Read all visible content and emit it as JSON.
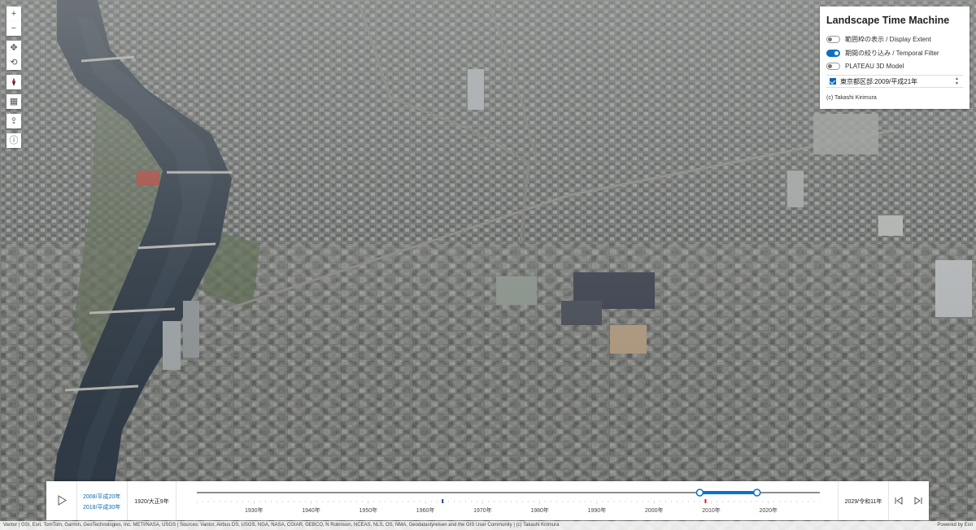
{
  "nav_tools": [
    {
      "name": "zoom-in-button",
      "icon": "plus-icon",
      "glyph": "+"
    },
    {
      "name": "zoom-out-button",
      "icon": "minus-icon",
      "glyph": "−"
    },
    {
      "name": "pan-button",
      "icon": "move-icon",
      "glyph": "✥"
    },
    {
      "name": "rotate-button",
      "icon": "rotate-icon",
      "glyph": "⟲"
    },
    {
      "name": "compass-button",
      "icon": "compass-icon",
      "glyph": "➹"
    },
    {
      "name": "daylight-button",
      "icon": "calendar-icon",
      "glyph": "▦"
    },
    {
      "name": "share-button",
      "icon": "share-icon",
      "glyph": "⇪"
    },
    {
      "name": "info-button",
      "icon": "info-icon",
      "glyph": "ⓘ"
    }
  ],
  "panel": {
    "title": "Landscape Time Machine",
    "toggles": [
      {
        "label": "範囲枠の表示 / Display Extent",
        "on": false
      },
      {
        "label": "期間の絞り込み / Temporal Filter",
        "on": true
      },
      {
        "label": "PLATEAU 3D Model",
        "on": false
      }
    ],
    "layer_select": "東京都区部:2009/平成21年",
    "credit": "(c) Takashi Kirimura"
  },
  "timeline": {
    "range_start": "2008/平成20年",
    "range_end": "2018/平成30年",
    "min_label": "1920/大正9年",
    "max_label": "2029/令和11年",
    "min_year": 1920,
    "max_year": 2029,
    "selected_start_year": 2008,
    "selected_end_year": 2018,
    "current_marker_year": 2009,
    "blue_marker_year": 1963,
    "decade_labels": [
      "1930年",
      "1940年",
      "1950年",
      "1960年",
      "1970年",
      "1980年",
      "1990年",
      "2000年",
      "2010年",
      "2020年"
    ]
  },
  "attribution": "Vantor | GSI, Esri, TomTom, Garmin, GeoTechnologies, Inc, METI/NASA, USGS | Sources: Vantor, Airbus DS, USGS, NGA, NASA, CGIAR, GEBCO, N Robinson, NCEAS, NLS, OS, NMA, Geodatastyrelsen and the GIS User Community | (c) Takashi Kirimura",
  "powered_by": "Powered by Esri",
  "colors": {
    "accent": "#0b72c2",
    "marker_red": "#d9211d"
  }
}
